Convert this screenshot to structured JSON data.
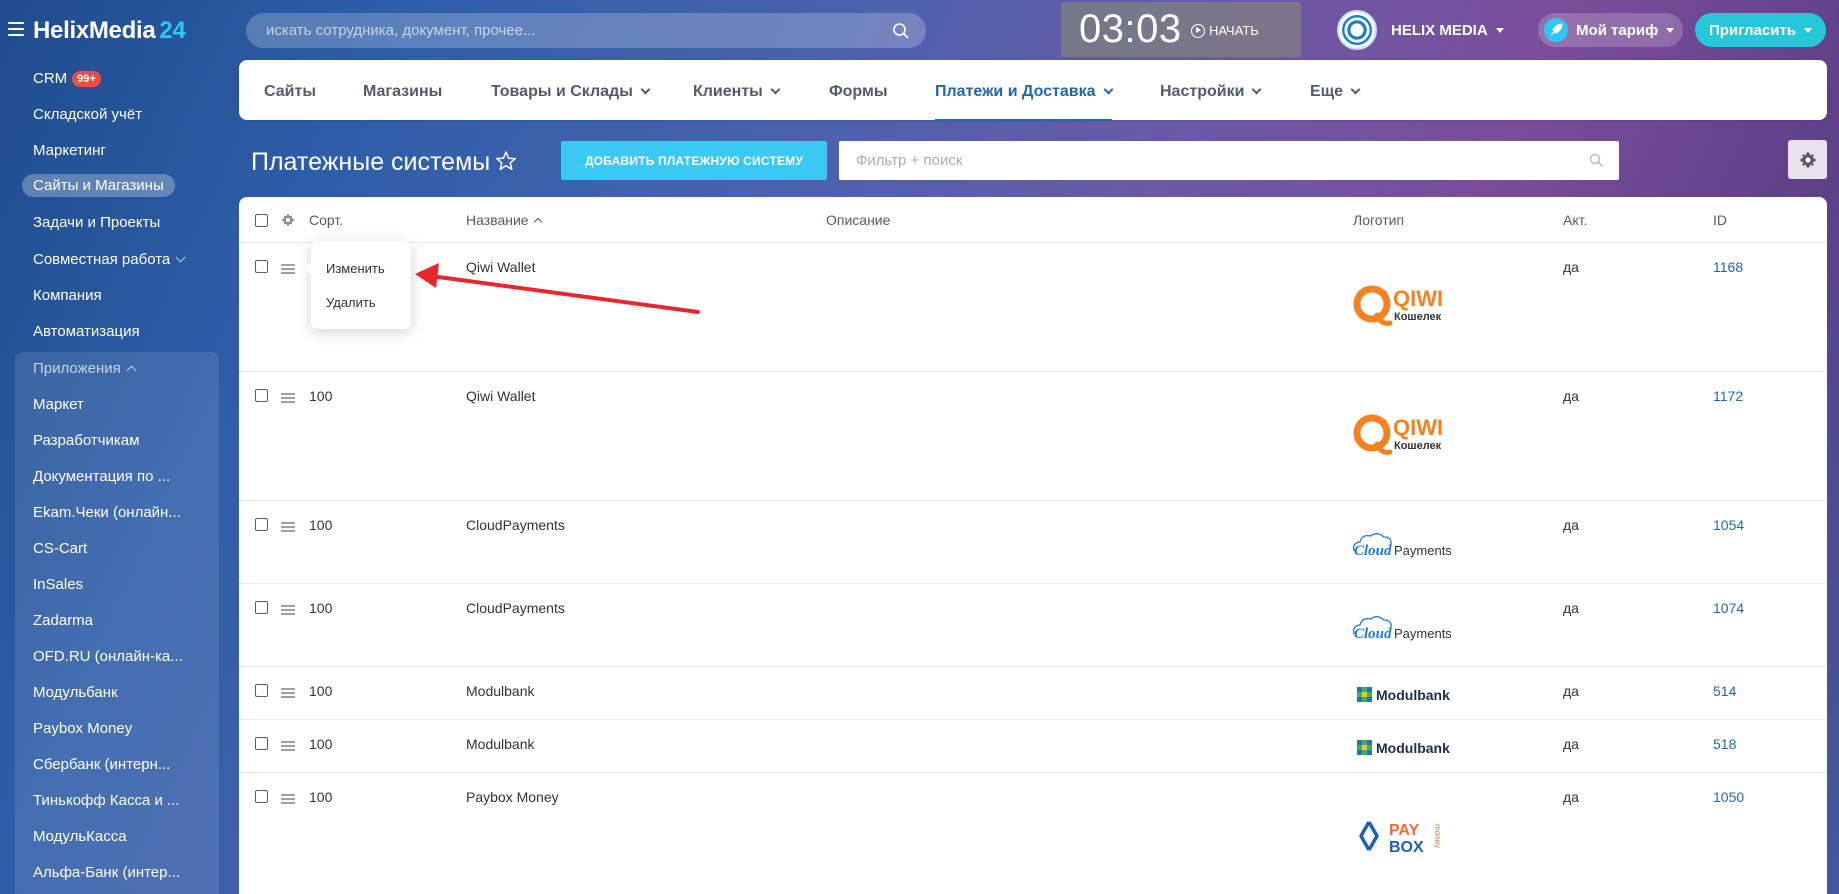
{
  "header": {
    "logo_main": "HelixMedia",
    "logo_num": "24",
    "search_placeholder": "искать сотрудника, документ, прочее...",
    "timer_time": "03:03",
    "timer_start": "НАЧАТЬ",
    "company_name": "HELIX MEDIA",
    "tariff_label": "Мой тариф",
    "invite_label": "Пригласить"
  },
  "sidebar": {
    "items": [
      {
        "label": "CRM",
        "badge": "99+"
      },
      {
        "label": "Складской учёт"
      },
      {
        "label": "Маркетинг"
      },
      {
        "label": "Сайты и Магазины",
        "active": true
      },
      {
        "label": "Задачи и Проекты"
      },
      {
        "label": "Совместная работа"
      },
      {
        "label": "Компания"
      },
      {
        "label": "Автоматизация"
      }
    ],
    "apps_title": "Приложения",
    "apps": [
      "Маркет",
      "Разработчикам",
      "Документация по ...",
      "Ekam.Чеки (онлайн...",
      "CS-Cart",
      "InSales",
      "Zadarma",
      "OFD.RU (онлайн-ка...",
      "Модульбанк",
      "Paybox Money",
      "Сбербанк (интерн...",
      "Тинькофф Касса и ...",
      "МодульКасса",
      "Альфа-Банк (интер..."
    ]
  },
  "nav": {
    "tabs": [
      {
        "label": "Сайты"
      },
      {
        "label": "Магазины"
      },
      {
        "label": "Товары и Склады"
      },
      {
        "label": "Клиенты"
      },
      {
        "label": "Формы"
      },
      {
        "label": "Платежи и Доставка"
      },
      {
        "label": "Настройки"
      },
      {
        "label": "Еще"
      }
    ]
  },
  "page": {
    "title": "Платежные системы",
    "add_button": "ДОБАВИТЬ ПЛАТЕЖНУЮ СИСТЕМУ",
    "filter_placeholder": "Фильтр + поиск"
  },
  "table": {
    "headers": {
      "sort": "Сорт.",
      "name": "Название",
      "description": "Описание",
      "logo": "Логотип",
      "active": "Акт.",
      "id": "ID"
    },
    "rows": [
      {
        "sort": "",
        "name": "Qiwi Wallet",
        "active": "да",
        "id": "1168",
        "logo": "qiwi"
      },
      {
        "sort": "100",
        "name": "Qiwi Wallet",
        "active": "да",
        "id": "1172",
        "logo": "qiwi"
      },
      {
        "sort": "100",
        "name": "CloudPayments",
        "active": "да",
        "id": "1054",
        "logo": "cloud"
      },
      {
        "sort": "100",
        "name": "CloudPayments",
        "active": "да",
        "id": "1074",
        "logo": "cloud"
      },
      {
        "sort": "100",
        "name": "Modulbank",
        "active": "да",
        "id": "514",
        "logo": "modul"
      },
      {
        "sort": "100",
        "name": "Modulbank",
        "active": "да",
        "id": "518",
        "logo": "modul"
      },
      {
        "sort": "100",
        "name": "Paybox Money",
        "active": "да",
        "id": "1050",
        "logo": "paybox"
      }
    ],
    "logos": {
      "qiwi_word": "QIWI",
      "qiwi_sub": "Кошелек",
      "cloud_word": "Cloud",
      "cloud_sub": "Payments",
      "modul_word": "Modulbank",
      "paybox_pay": "PAY",
      "paybox_box": "BOX",
      "paybox_money": "money"
    }
  },
  "context_menu": {
    "edit": "Изменить",
    "delete": "Удалить"
  },
  "colors": {
    "accent": "#2fc6f6",
    "link": "#2067b0",
    "invite": "#25c7d8",
    "badge": "#f04c3f",
    "annotation_arrow": "#e8262b",
    "qiwi": "#f58220"
  }
}
